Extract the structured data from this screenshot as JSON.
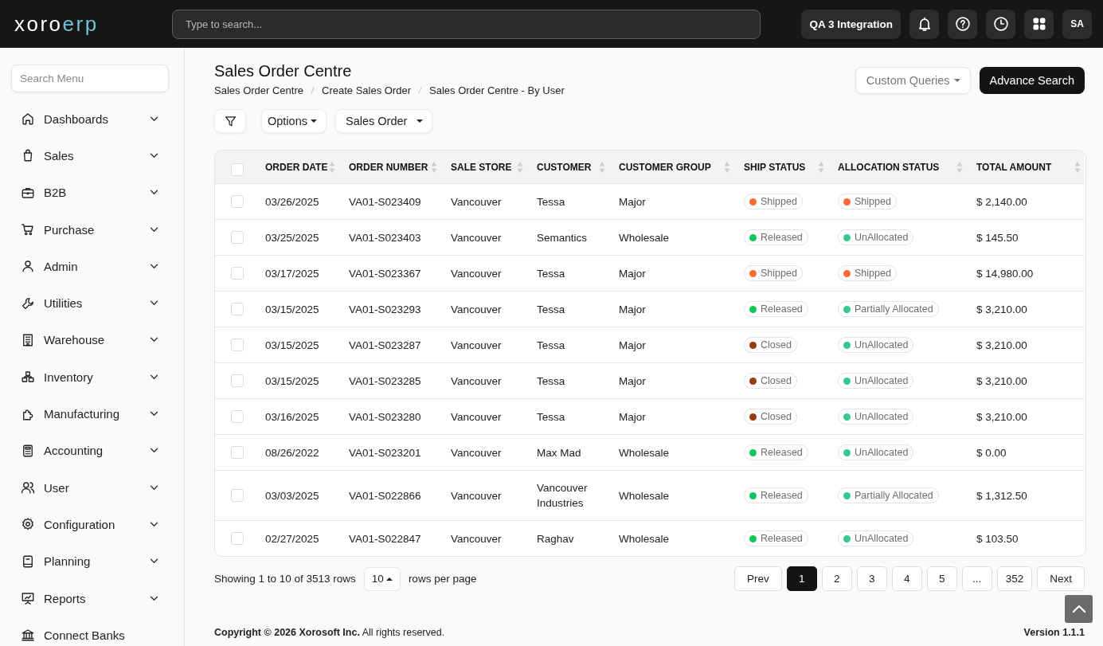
{
  "header": {
    "logo": {
      "part_1": "xoro",
      "part_2": "erp"
    },
    "search": {
      "placeholder": "Type to search..."
    },
    "company_button": "QA 3 Integration",
    "avatar": "SA"
  },
  "sidebar": {
    "search": {
      "placeholder": "Search Menu"
    },
    "items": [
      {
        "label": "Dashboards",
        "kind": "group",
        "expanded": false
      },
      {
        "label": "Sales",
        "kind": "group",
        "expanded": false
      },
      {
        "label": "B2B",
        "kind": "group",
        "expanded": false
      },
      {
        "label": "Purchase",
        "kind": "group",
        "expanded": false
      },
      {
        "label": "Admin",
        "kind": "group",
        "expanded": false
      },
      {
        "label": "Utilities",
        "kind": "group",
        "expanded": false
      },
      {
        "label": "Warehouse",
        "kind": "group",
        "expanded": false
      },
      {
        "label": "Inventory",
        "kind": "group",
        "expanded": false
      },
      {
        "label": "Manufacturing",
        "kind": "group",
        "expanded": false
      },
      {
        "label": "Accounting",
        "kind": "group",
        "expanded": false
      },
      {
        "label": "User",
        "kind": "group",
        "expanded": false
      },
      {
        "label": "Configuration",
        "kind": "group",
        "expanded": false
      },
      {
        "label": "Planning",
        "kind": "group",
        "expanded": false
      },
      {
        "label": "Reports",
        "kind": "group",
        "expanded": false
      },
      {
        "label": "Connect Banks",
        "kind": "link"
      }
    ]
  },
  "page": {
    "title": "Sales Order Centre",
    "breadcrumbs": [
      "Sales Order Centre",
      "Create Sales Order",
      "Sales Order Centre - By User"
    ],
    "custom_queries_button": "Custom Queries",
    "advance_search_button": "Advance Search"
  },
  "toolbar": {
    "options_button": "Options",
    "view_dropdown": "Sales Order"
  },
  "table": {
    "all_checked": false,
    "columns": [
      "ORDER DATE",
      "ORDER NUMBER",
      "SALE STORE",
      "CUSTOMER",
      "CUSTOMER GROUP",
      "SHIP STATUS",
      "ALLOCATION STATUS",
      "TOTAL AMOUNT"
    ],
    "rows": [
      {
        "checked": false,
        "order_date": "03/26/2025",
        "order_number": "VA01-S023409",
        "sale_store": "Vancouver",
        "customer": "Tessa",
        "customer_group": "Major",
        "ship_status": {
          "label": "Shipped",
          "color": "#ff6b35"
        },
        "allocation_status": {
          "label": "Shipped",
          "color": "#ff6b35"
        },
        "total_amount": "$ 2,140.00"
      },
      {
        "checked": false,
        "order_date": "03/25/2025",
        "order_number": "VA01-S023403",
        "sale_store": "Vancouver",
        "customer": "Semantics",
        "customer_group": "Wholesale",
        "ship_status": {
          "label": "Released",
          "color": "#12c65c"
        },
        "allocation_status": {
          "label": "UnAllocated",
          "color": "#34c98e"
        },
        "total_amount": "$ 145.50"
      },
      {
        "checked": false,
        "order_date": "03/17/2025",
        "order_number": "VA01-S023367",
        "sale_store": "Vancouver",
        "customer": "Tessa",
        "customer_group": "Major",
        "ship_status": {
          "label": "Shipped",
          "color": "#ff6b35"
        },
        "allocation_status": {
          "label": "Shipped",
          "color": "#ff6b35"
        },
        "total_amount": "$ 14,980.00"
      },
      {
        "checked": false,
        "order_date": "03/15/2025",
        "order_number": "VA01-S023293",
        "sale_store": "Vancouver",
        "customer": "Tessa",
        "customer_group": "Major",
        "ship_status": {
          "label": "Released",
          "color": "#12c65c"
        },
        "allocation_status": {
          "label": "Partially Allocated",
          "color": "#34c98e"
        },
        "total_amount": "$ 3,210.00"
      },
      {
        "checked": false,
        "order_date": "03/15/2025",
        "order_number": "VA01-S023287",
        "sale_store": "Vancouver",
        "customer": "Tessa",
        "customer_group": "Major",
        "ship_status": {
          "label": "Closed",
          "color": "#9a3b0c"
        },
        "allocation_status": {
          "label": "UnAllocated",
          "color": "#34c98e"
        },
        "total_amount": "$ 3,210.00"
      },
      {
        "checked": false,
        "order_date": "03/15/2025",
        "order_number": "VA01-S023285",
        "sale_store": "Vancouver",
        "customer": "Tessa",
        "customer_group": "Major",
        "ship_status": {
          "label": "Closed",
          "color": "#9a3b0c"
        },
        "allocation_status": {
          "label": "UnAllocated",
          "color": "#34c98e"
        },
        "total_amount": "$ 3,210.00"
      },
      {
        "checked": false,
        "order_date": "03/16/2025",
        "order_number": "VA01-S023280",
        "sale_store": "Vancouver",
        "customer": "Tessa",
        "customer_group": "Major",
        "ship_status": {
          "label": "Closed",
          "color": "#9a3b0c"
        },
        "allocation_status": {
          "label": "UnAllocated",
          "color": "#34c98e"
        },
        "total_amount": "$ 3,210.00"
      },
      {
        "checked": false,
        "order_date": "08/26/2022",
        "order_number": "VA01-S023201",
        "sale_store": "Vancouver",
        "customer": "Max Mad",
        "customer_group": "Wholesale",
        "ship_status": {
          "label": "Released",
          "color": "#12c65c"
        },
        "allocation_status": {
          "label": "UnAllocated",
          "color": "#34c98e"
        },
        "total_amount": "$ 0.00"
      },
      {
        "checked": false,
        "order_date": "03/03/2025",
        "order_number": "VA01-S022866",
        "sale_store": "Vancouver",
        "customer": "Vancouver Industries",
        "customer_group": "Wholesale",
        "ship_status": {
          "label": "Released",
          "color": "#12c65c"
        },
        "allocation_status": {
          "label": "Partially Allocated",
          "color": "#34c98e"
        },
        "total_amount": "$ 1,312.50"
      },
      {
        "checked": false,
        "order_date": "02/27/2025",
        "order_number": "VA01-S022847",
        "sale_store": "Vancouver",
        "customer": "Raghav",
        "customer_group": "Wholesale",
        "ship_status": {
          "label": "Released",
          "color": "#12c65c"
        },
        "allocation_status": {
          "label": "UnAllocated",
          "color": "#34c98e"
        },
        "total_amount": "$ 103.50"
      }
    ]
  },
  "pagination": {
    "summary": "Showing 1 to 10 of 3513 rows",
    "page_size": "10",
    "page_size_label": "rows per page",
    "prev": "Prev",
    "pages": [
      {
        "label": "1",
        "selected": true
      },
      {
        "label": "2",
        "selected": false
      },
      {
        "label": "3",
        "selected": false
      },
      {
        "label": "4",
        "selected": false
      },
      {
        "label": "5",
        "selected": false
      },
      {
        "label": "...",
        "selected": false
      },
      {
        "label": "352",
        "selected": false
      }
    ],
    "next": "Next"
  },
  "footer": {
    "copyright": "**Copyright © 2026 Xorosoft Inc.** All rights reserved.",
    "version": "Version 1.1.1"
  }
}
